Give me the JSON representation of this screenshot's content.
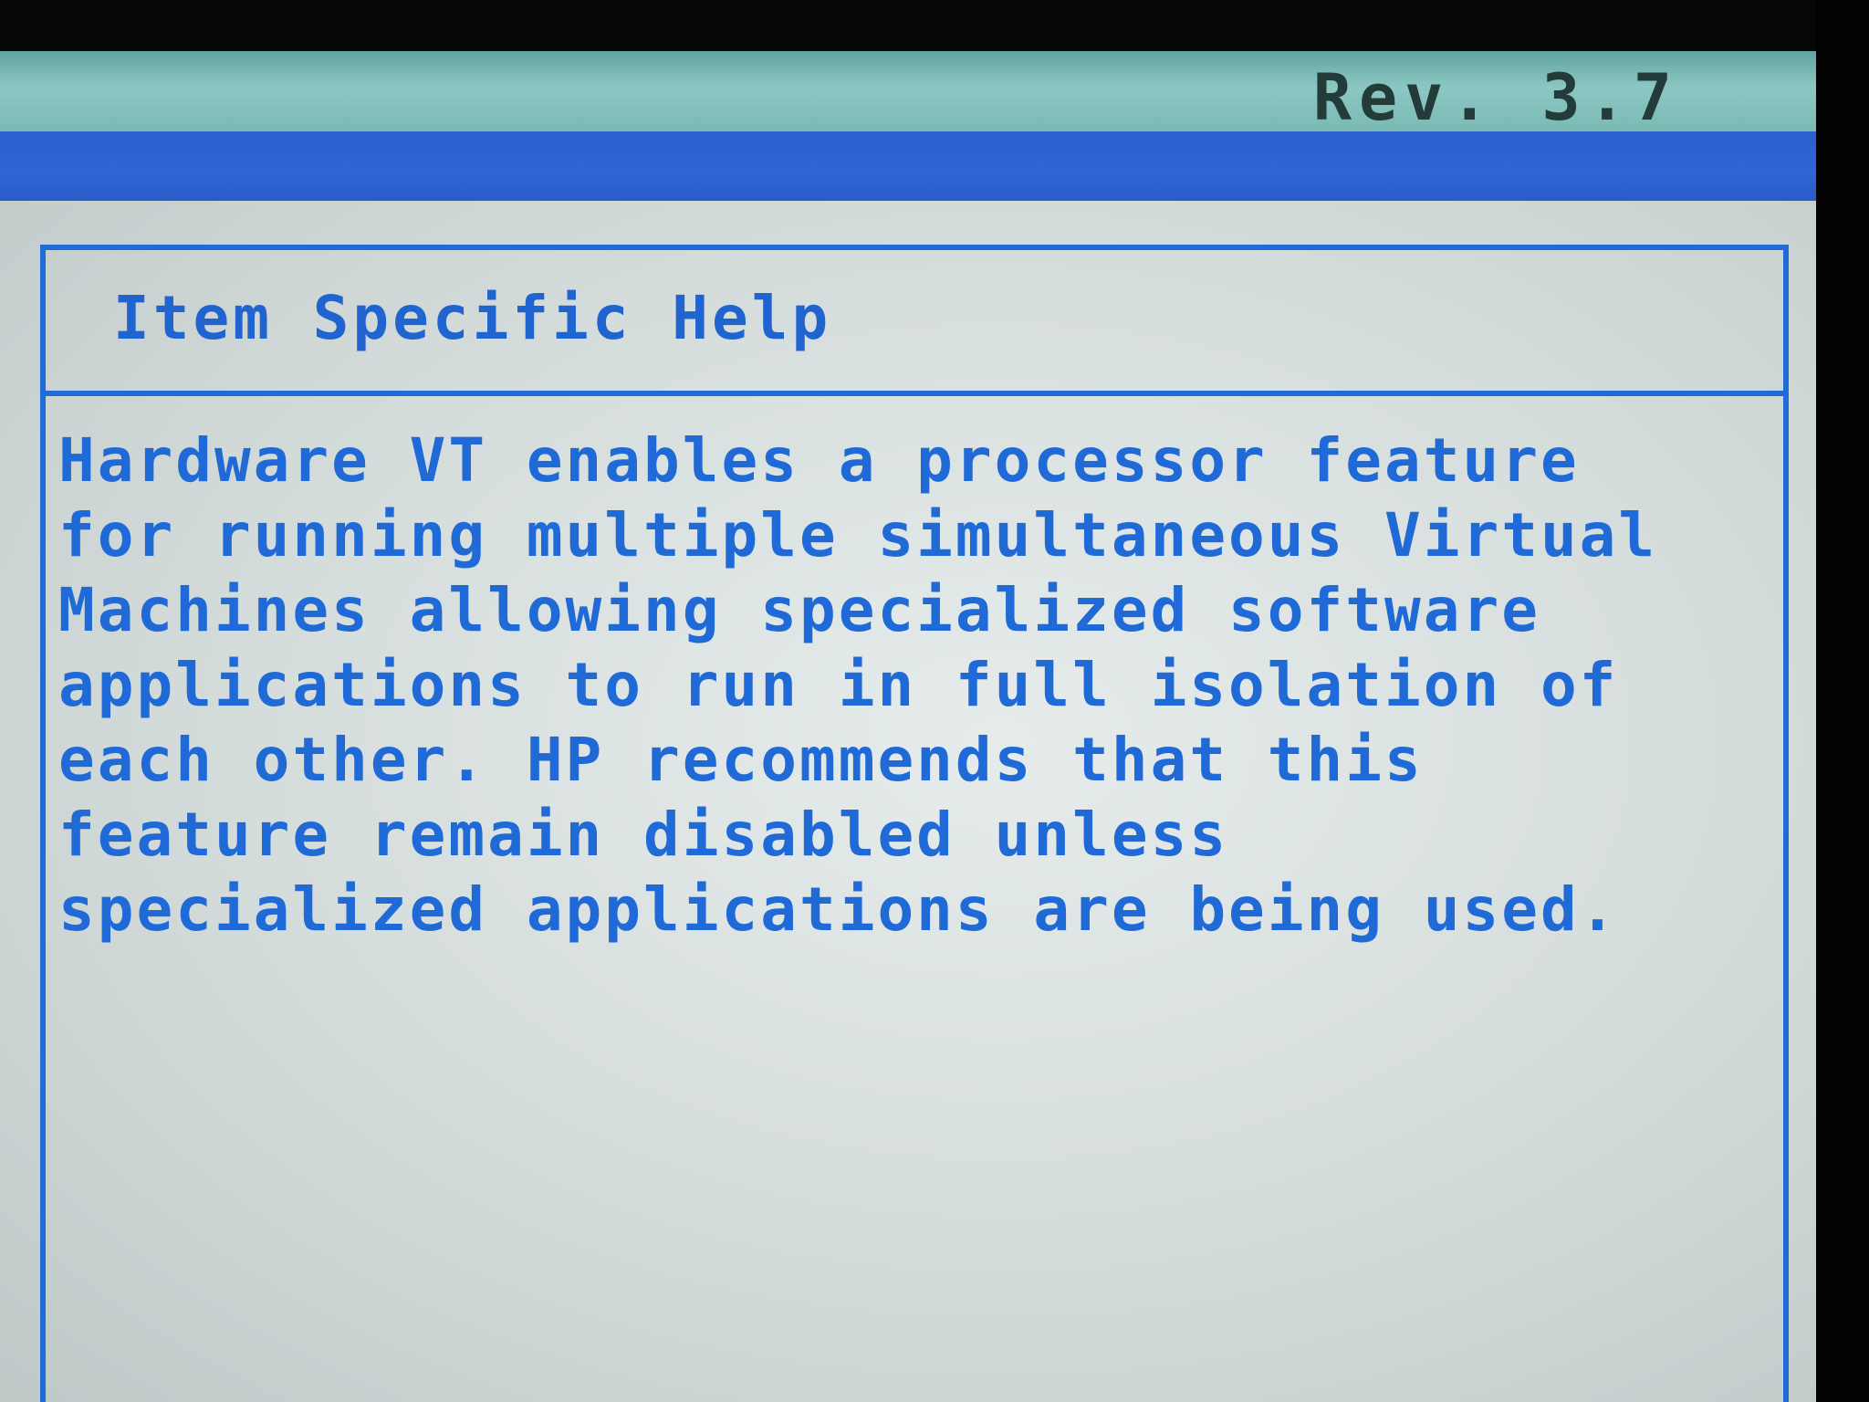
{
  "header": {
    "revision": "Rev. 3.7"
  },
  "help": {
    "title": "Item Specific Help",
    "lines": [
      "Hardware VT enables a processor feature",
      "for running multiple simultaneous Virtual",
      "Machines allowing specialized software",
      "applications to run in full isolation of",
      "each other. HP recommends that this",
      "feature remain disabled unless",
      "specialized applications are being used."
    ]
  },
  "colors": {
    "text_blue": "#1f6ad6",
    "border_blue": "#1f6cd9",
    "title_bar_teal": "#8cc7c3",
    "menu_bar_blue": "#2f66d8",
    "panel_gray": "#dde4e3"
  }
}
